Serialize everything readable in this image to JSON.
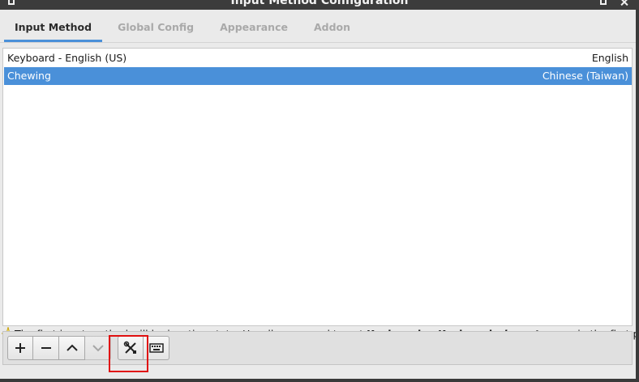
{
  "window": {
    "title": "Input Method Configuration"
  },
  "tabs": [
    {
      "label": "Input Method",
      "active": true
    },
    {
      "label": "Global Config",
      "active": false
    },
    {
      "label": "Appearance",
      "active": false
    },
    {
      "label": "Addon",
      "active": false
    }
  ],
  "input_methods": [
    {
      "name": "Keyboard - English (US)",
      "language": "English",
      "selected": false
    },
    {
      "name": "Chewing",
      "language": "Chinese (Taiwan)",
      "selected": true
    }
  ],
  "hint": {
    "part1": "The first input method will be inactive state. Usually you need to put ",
    "bold1": "Keyboard",
    "part2": " or ",
    "bold2": "Keyboard - ",
    "italic": "layout name",
    "part3": " in the first place."
  },
  "toolbar": {
    "buttons": [
      {
        "icon": "plus-icon",
        "label": "Add"
      },
      {
        "icon": "minus-icon",
        "label": "Remove"
      },
      {
        "icon": "chevron-up-icon",
        "label": "Move Up"
      },
      {
        "icon": "chevron-down-icon",
        "label": "Move Down"
      },
      {
        "icon": "configure-tools-icon",
        "label": "Configure"
      },
      {
        "icon": "keyboard-icon",
        "label": "Keyboard Layout"
      }
    ]
  },
  "colors": {
    "accent": "#4a90d9",
    "highlight_box": "#e01010"
  }
}
